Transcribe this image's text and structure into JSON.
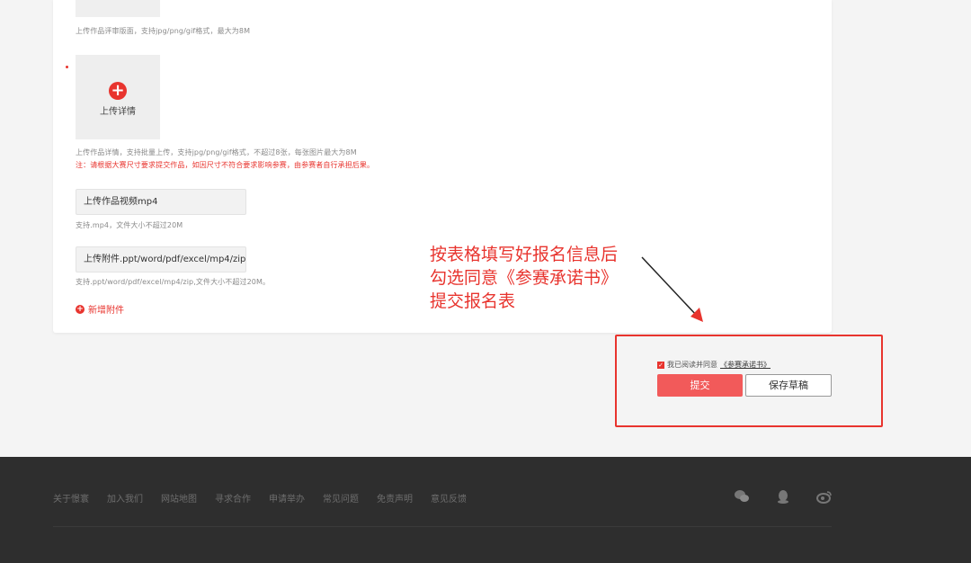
{
  "form": {
    "cover_hint": "上传作品评审版面，支持jpg/png/gif格式，最大为8M",
    "detail_upload_label": "上传详情",
    "detail_hint": "上传作品详情，支持批量上传，支持jpg/png/gif格式，不超过8张，每张图片最大为8M",
    "detail_note": "注：请根据大赛尺寸要求提交作品，如因尺寸不符合要求影响参赛，由参赛者自行承担后果。",
    "video_button": "上传作品视频mp4",
    "video_hint": "支持.mp4，文件大小不超过20M",
    "attach_button": "上传附件.ppt/word/pdf/excel/mp4/zip",
    "attach_hint": "支持.ppt/word/pdf/excel/mp4/zip,文件大小不超过20M。",
    "add_attach_label": "新增附件"
  },
  "annotation": {
    "line1": "按表格填写好报名信息后",
    "line2": "勾选同意《参赛承诺书》",
    "line3": "提交报名表",
    "color": "#e8342e"
  },
  "submit": {
    "agree_text": "我已阅读并同意",
    "agree_link": "《参赛承诺书》",
    "agreed": true,
    "submit_label": "提交",
    "draft_label": "保存草稿"
  },
  "footer": {
    "links": [
      "关于憬寰",
      "加入我们",
      "网站地图",
      "寻求合作",
      "申请举办",
      "常见问题",
      "免责声明",
      "意见反馈"
    ],
    "icons": [
      "wechat-icon",
      "qq-icon",
      "weibo-icon"
    ]
  }
}
